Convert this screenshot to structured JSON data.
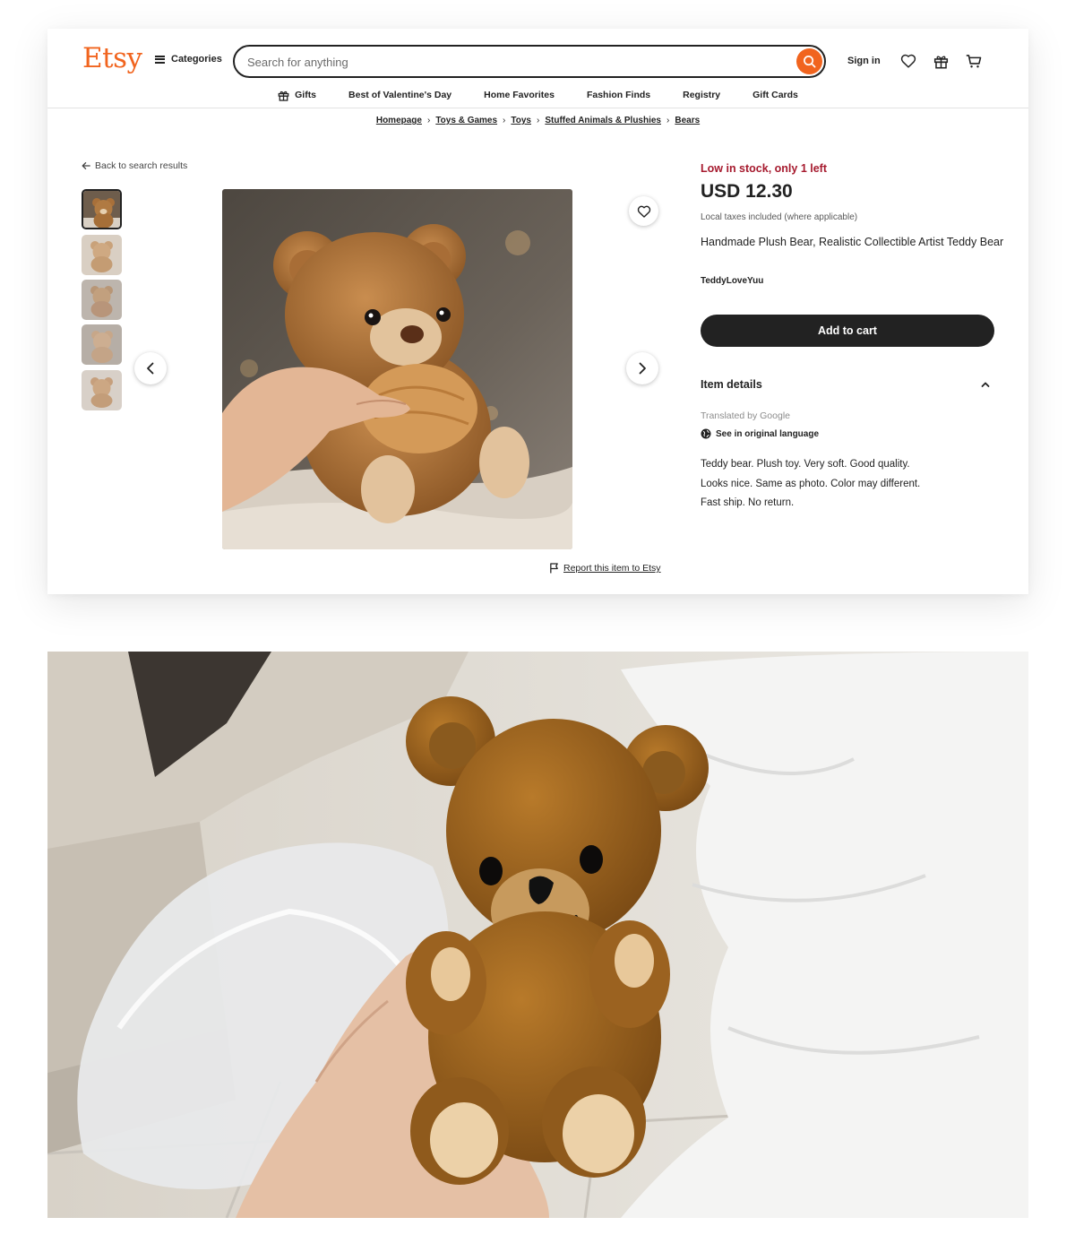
{
  "header": {
    "logo": "Etsy",
    "categories_label": "Categories",
    "search_placeholder": "Search for anything",
    "sign_in": "Sign in"
  },
  "nav": {
    "items": [
      "Gifts",
      "Best of Valentine's Day",
      "Home Favorites",
      "Fashion Finds",
      "Registry",
      "Gift Cards"
    ]
  },
  "breadcrumb": [
    "Homepage",
    "Toys & Games",
    "Toys",
    "Stuffed Animals & Plushies",
    "Bears"
  ],
  "gallery": {
    "back_label": "Back to search results",
    "report_label": "Report this item to Etsy"
  },
  "product": {
    "stock": "Low in stock, only 1 left",
    "price": "USD 12.30",
    "tax_note": "Local taxes included (where applicable)",
    "title": "Handmade Plush Bear, Realistic Collectible Artist Teddy Bear",
    "shop": "TeddyLoveYuu",
    "add_to_cart": "Add to cart",
    "details_heading": "Item details",
    "translated_by": "Translated by Google",
    "see_original": "See in original language",
    "description": [
      "Teddy bear. Plush toy. Very soft. Good quality.",
      "Looks nice. Same as photo. Color may different.",
      "Fast ship. No return."
    ]
  },
  "colors": {
    "brand": "#F1641E",
    "stock_red": "#A61A2E",
    "button_dark": "#222222"
  }
}
